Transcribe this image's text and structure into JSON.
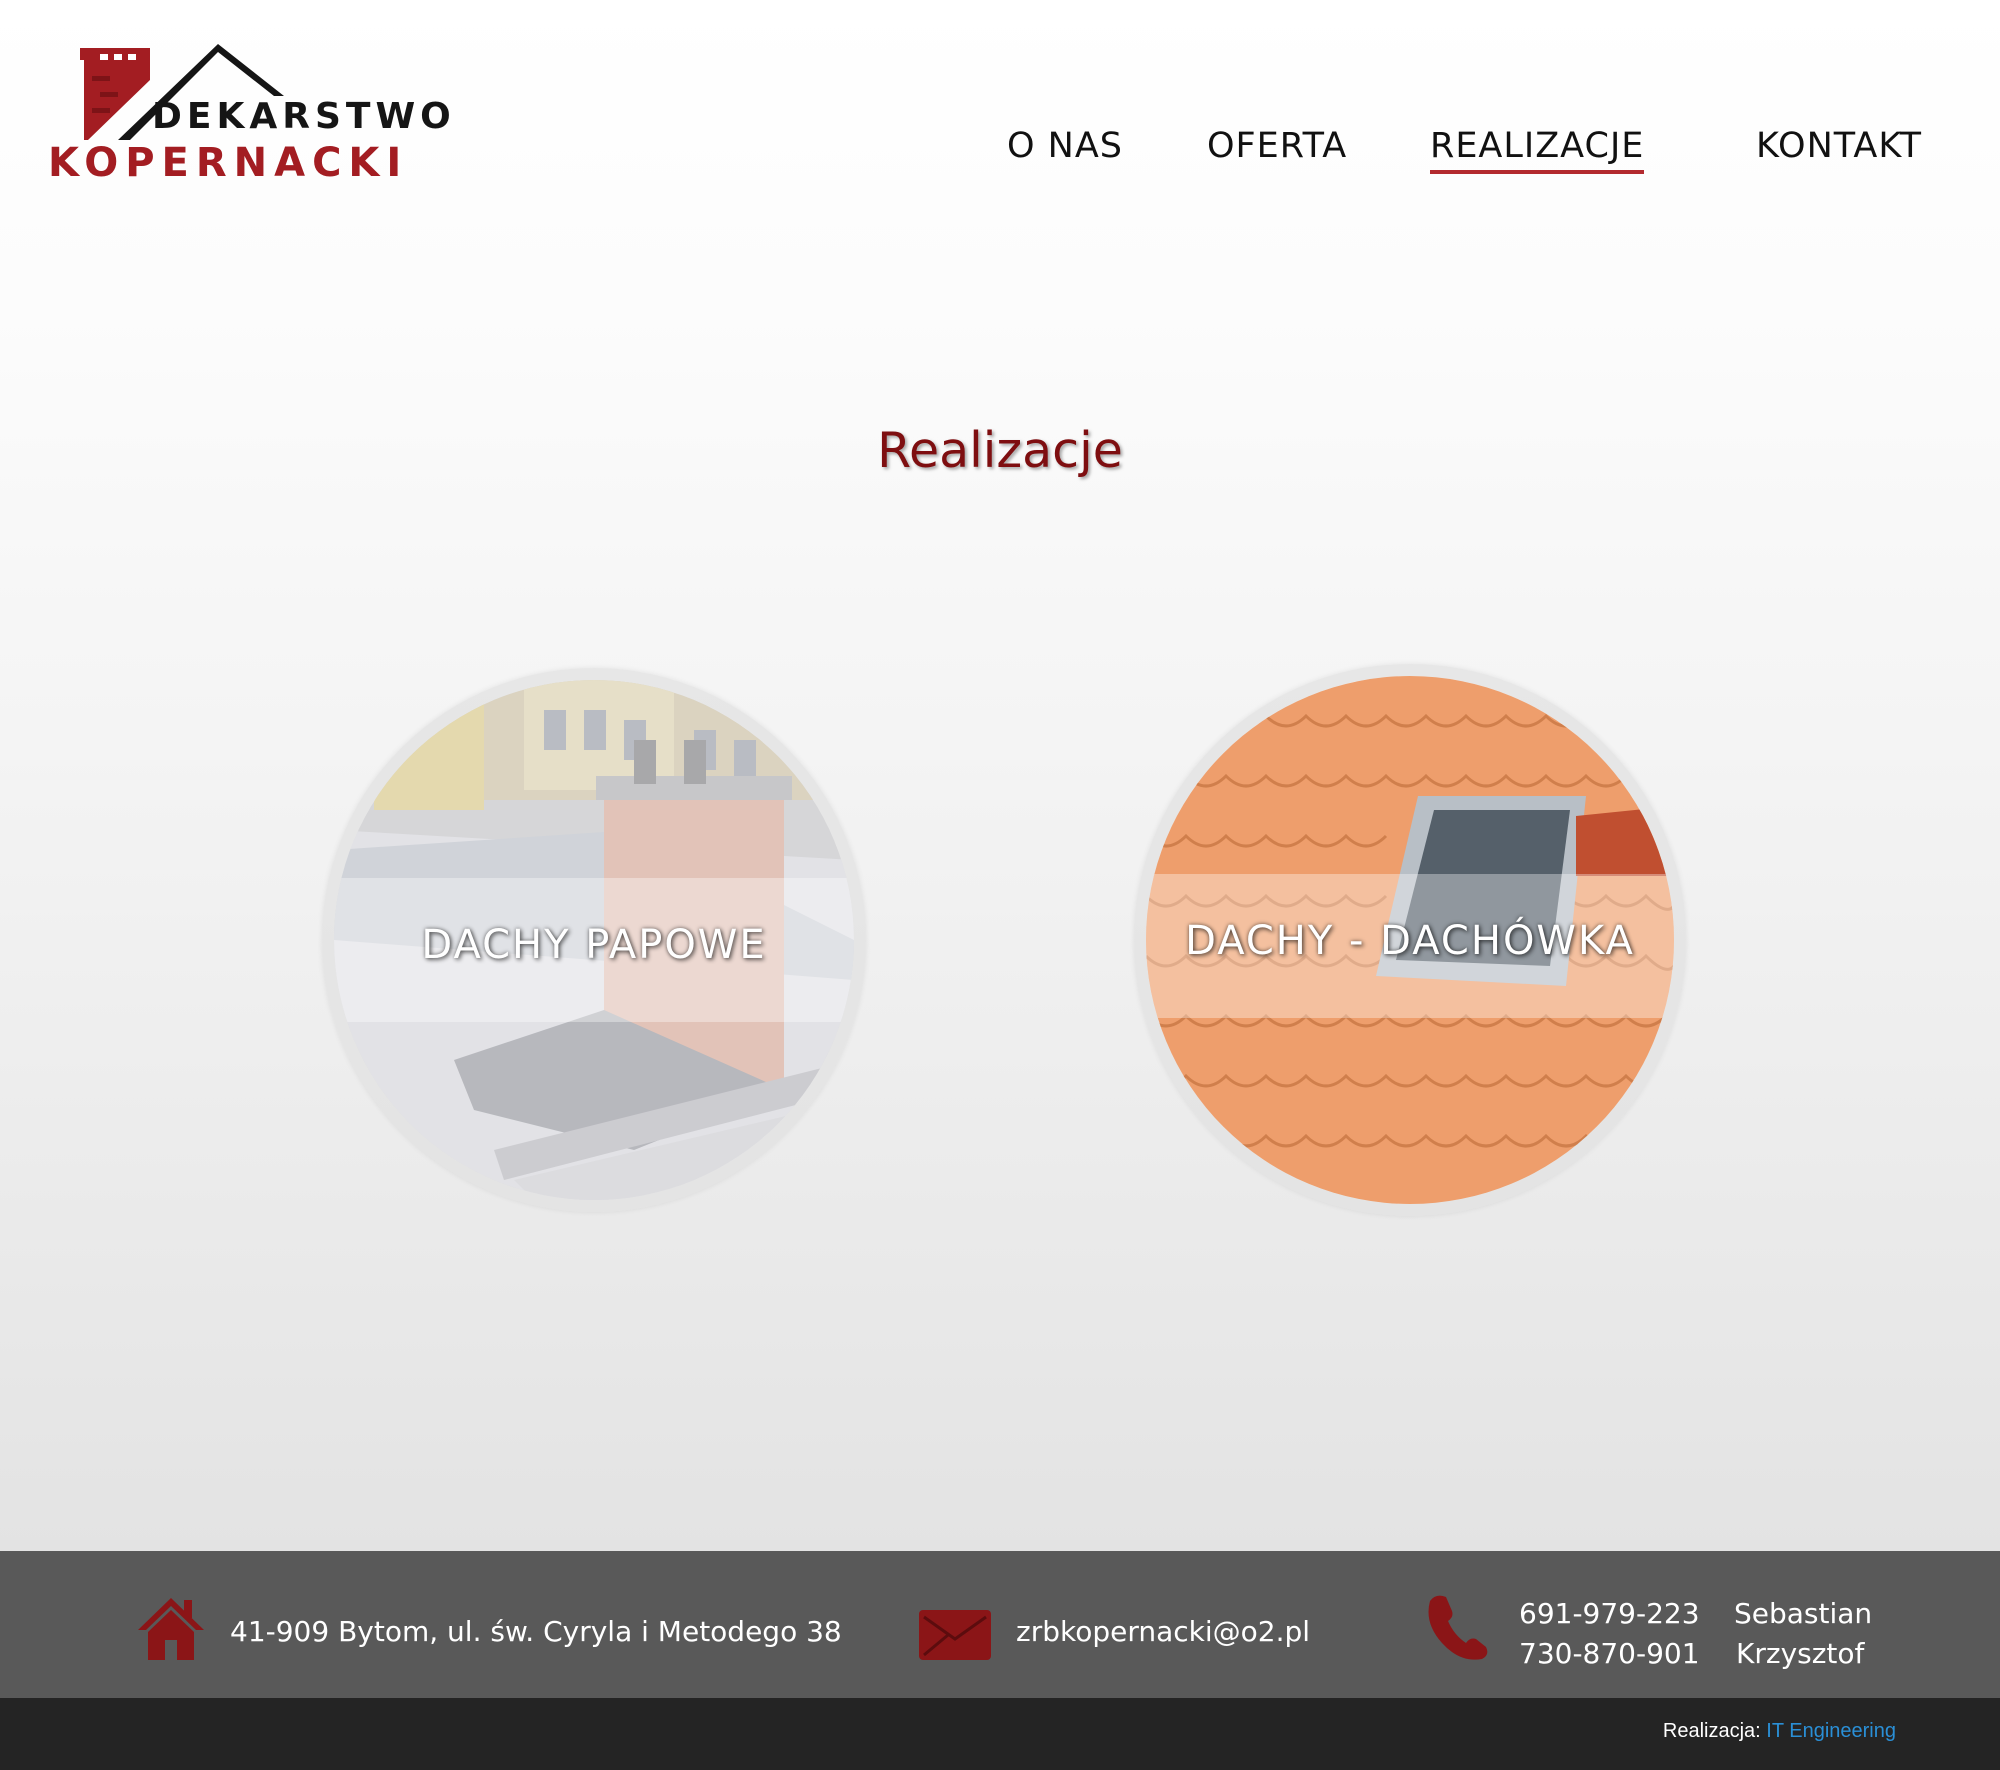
{
  "header": {
    "logo_top": "DEKARSTWO",
    "logo_bottom": "KOPERNACKI",
    "nav": [
      "O NAS",
      "OFERTA",
      "REALIZACJE",
      "KONTAKT"
    ],
    "active_nav": "REALIZACJE"
  },
  "main": {
    "title": "Realizacje",
    "cards": [
      {
        "label": "DACHY PAPOWE",
        "image": "flat-tar-paper-roof-with-chimney"
      },
      {
        "label": "DACHY - DACHÓWKA",
        "image": "orange-clay-tile-roof-with-skylight"
      }
    ]
  },
  "footer": {
    "address": "41-909 Bytom, ul. św. Cyryla i Metodego 38",
    "email": "zrbkopernacki@o2.pl",
    "phones": [
      "691-979-223",
      "730-870-901"
    ],
    "names": [
      "Sebastian",
      "Krzysztof"
    ],
    "credit_label": "Realizacja:",
    "credit_link": "IT Engineering",
    "icons": {
      "address": "house-icon",
      "email": "envelope-icon",
      "phone": "phone-icon"
    }
  },
  "colors": {
    "brand_red": "#a31d22",
    "title_red": "#7e0e10",
    "footer_bg": "#595959",
    "bottom_bar": "#242424",
    "link_blue": "#2a8fd6"
  }
}
